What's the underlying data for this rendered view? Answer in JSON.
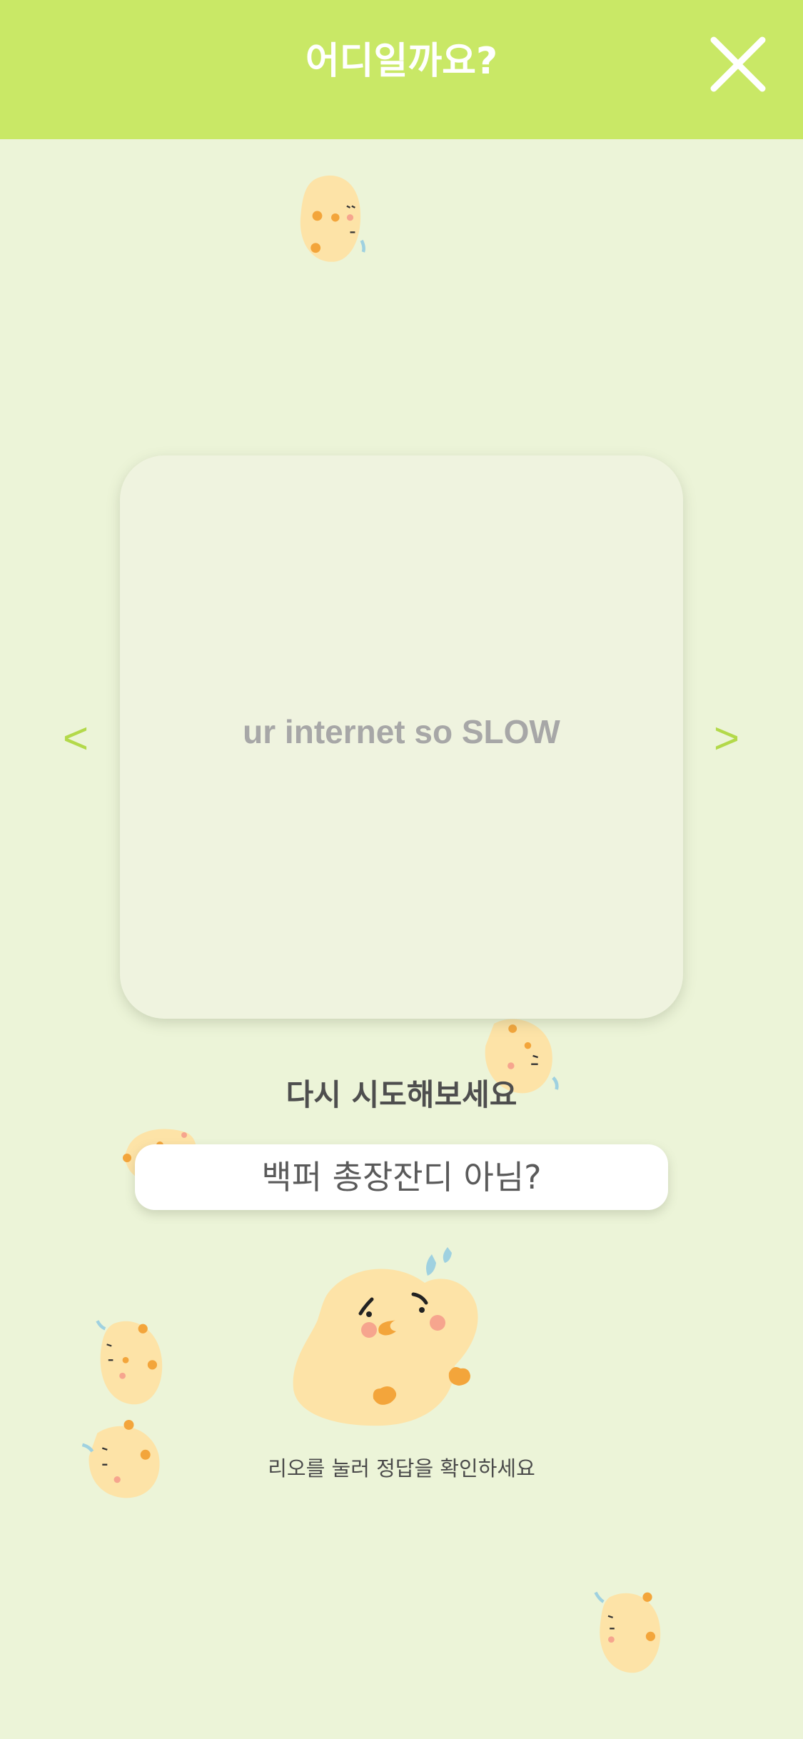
{
  "header": {
    "title": "어디일까요?"
  },
  "card": {
    "message": "ur internet so SLOW"
  },
  "nav": {
    "prev": "<",
    "next": ">"
  },
  "quiz": {
    "status": "다시 시도해보세요",
    "answer": "백퍼 총장잔디 아님?",
    "hint": "리오를 눌러 정답을 확인하세요"
  },
  "colors": {
    "header_bg": "#c9e866",
    "page_bg": "#ecf4d8",
    "accent": "#b3d94a",
    "chick_body": "#fde3a7",
    "chick_beak": "#f3a53b",
    "chick_cheek": "#f6a58e",
    "drop": "#9fd1e0"
  },
  "icons": {
    "close": "close-icon",
    "mascot": "chick-mascot-icon"
  }
}
